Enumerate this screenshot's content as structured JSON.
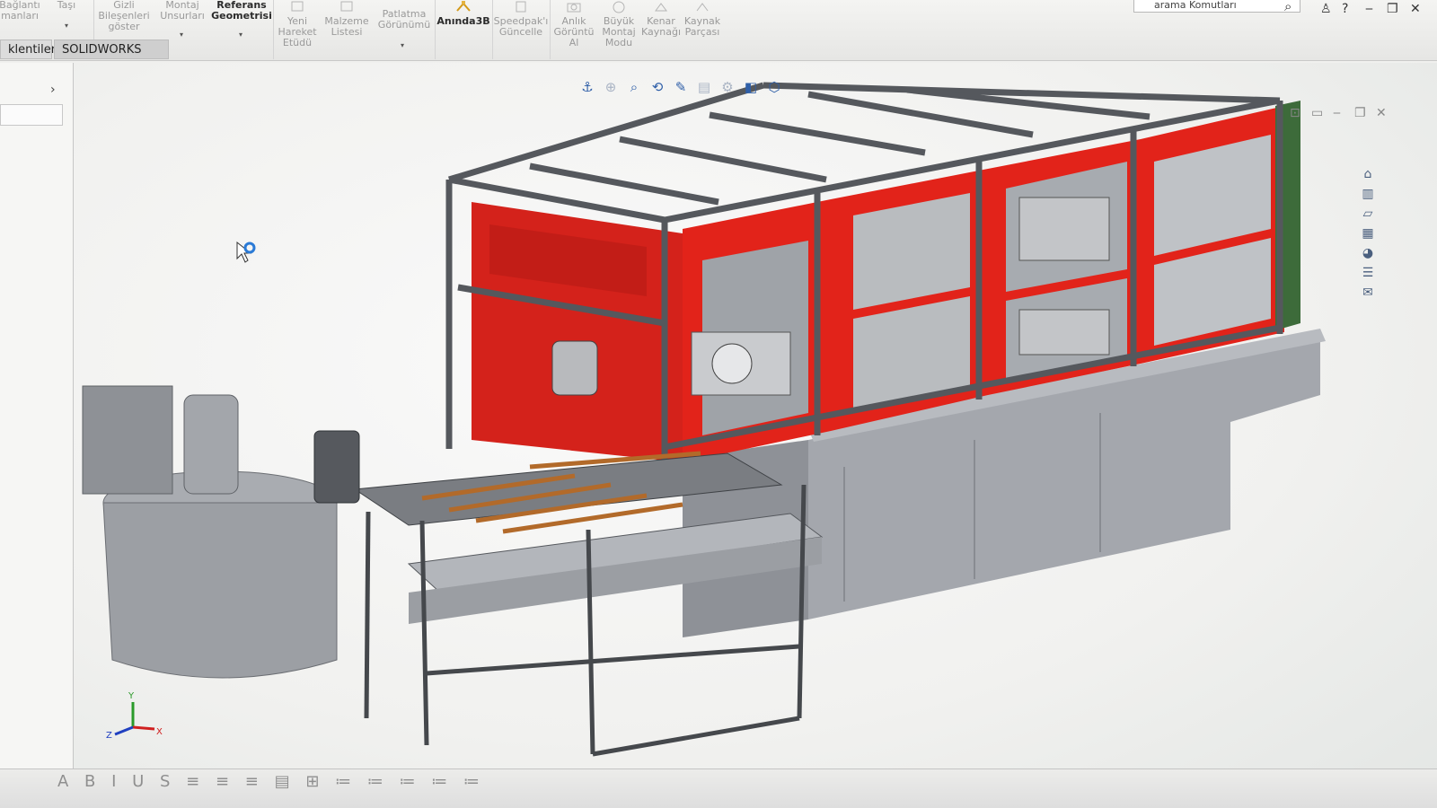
{
  "ribbon": {
    "buttons": [
      {
        "label": "Bağlantı\nmanları",
        "icon": "mate-icon"
      },
      {
        "label": "Taşı",
        "icon": "move-icon"
      },
      {
        "label": "Gizli\nBileşenleri\ngöster",
        "icon": "show-hidden-icon"
      },
      {
        "label": "Montaj\nUnsurları",
        "icon": "assembly-features-icon"
      },
      {
        "label": "Referans\nGeometrisi",
        "icon": "reference-geometry-icon"
      },
      {
        "label": "Yeni\nHareket\nEtüdü",
        "icon": "motion-study-icon"
      },
      {
        "label": "Malzeme\nListesi",
        "icon": "bom-icon"
      },
      {
        "label": "Patlatma\nGörünümü",
        "icon": "exploded-view-icon"
      },
      {
        "label": "Anında3B",
        "icon": "instant3d-icon"
      },
      {
        "label": "Speedpak'ı\nGüncelle",
        "icon": "speedpak-icon"
      },
      {
        "label": "Anlık\nGörüntü\nAl",
        "icon": "snapshot-icon"
      },
      {
        "label": "Büyük\nMontaj\nModu",
        "icon": "large-assembly-icon"
      },
      {
        "label": "Kenar\nKaynağı",
        "icon": "edge-weld-icon"
      },
      {
        "label": "Kaynak\nParçası",
        "icon": "weld-part-icon"
      }
    ],
    "search_text": "arama Komutları"
  },
  "tabs": [
    {
      "label": "klentileri"
    },
    {
      "label": "SOLIDWORKS MBD"
    }
  ],
  "hud_icons": [
    "view-orientation-icon",
    "zoom-to-fit-icon",
    "zoom-area-icon",
    "previous-view-icon",
    "section-view-icon",
    "dynamic-annotation-icon",
    "view-settings-icon",
    "display-style-icon",
    "hide-show-icon"
  ],
  "task_pane_icons": [
    "home-icon",
    "resources-icon",
    "design-library-icon",
    "file-explorer-icon",
    "view-palette-icon",
    "appearances-icon",
    "custom-properties-icon",
    "forum-icon"
  ],
  "colors": {
    "guard_red": "#e2231a",
    "frame_gray": "#6a6e73",
    "panel_gray": "#9a9ca2",
    "accent_blue": "#2f5fa8"
  },
  "triad": {
    "x": "X",
    "y": "Y",
    "z": "Z"
  }
}
